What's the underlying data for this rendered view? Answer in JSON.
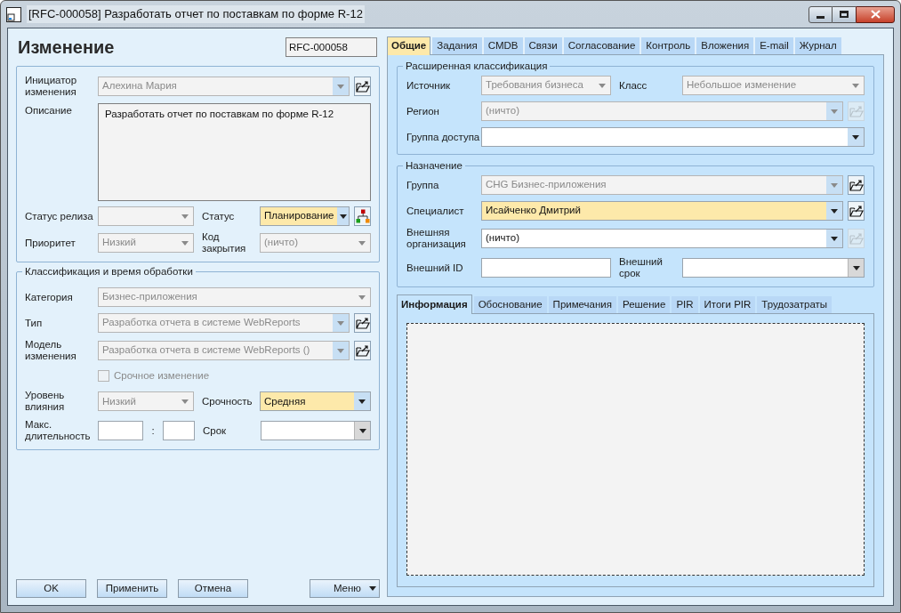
{
  "window": {
    "title": "[RFC-000058] Разработать отчет по поставкам по форме R-12"
  },
  "header": {
    "title": "Изменение",
    "number": "RFC-000058"
  },
  "main_section": {
    "rows": [
      {
        "fields": [
          {
            "label": "Инициатор изменения",
            "kind": "combo",
            "value": "Алехина Мария",
            "disabled": true,
            "highlighted": false,
            "button": {
              "kind": "link",
              "disabled": false
            }
          }
        ]
      },
      {
        "fields": [
          {
            "label": "Описание",
            "kind": "memo",
            "value": "Разработать отчет по поставкам по форме R-12",
            "disabled": true,
            "highlighted": false
          }
        ]
      },
      {
        "fields": [
          {
            "label": "Статус релиза",
            "kind": "combo",
            "disabled": true,
            "highlighted": false
          },
          {
            "label": "Статус",
            "kind": "combo",
            "value": "Планирование",
            "disabled": false,
            "highlighted": true,
            "button": {
              "kind": "tree",
              "disabled": false
            }
          }
        ]
      },
      {
        "fields": [
          {
            "label": "Приоритет",
            "kind": "combo",
            "value": "Низкий",
            "disabled": true,
            "highlighted": false
          },
          {
            "label": "Код закрытия",
            "kind": "combo",
            "value": "(ничто)",
            "disabled": true,
            "highlighted": false
          }
        ]
      }
    ]
  },
  "classification_section": {
    "legend": "Классификация и время обработки",
    "rows": [
      {
        "fields": [
          {
            "label": "Категория",
            "kind": "combo",
            "value": "Бизнес-приложения",
            "disabled": true,
            "highlighted": false
          }
        ]
      },
      {
        "fields": [
          {
            "label": "Тип",
            "kind": "combo",
            "value": "Разработка отчета в системе WebReports",
            "disabled": true,
            "highlighted": false,
            "button": {
              "kind": "link",
              "disabled": false
            }
          }
        ]
      },
      {
        "fields": [
          {
            "label": "Модель изменения",
            "kind": "combo",
            "value": "Разработка отчета в системе WebReports ()",
            "disabled": true,
            "highlighted": false,
            "button": {
              "kind": "link",
              "disabled": false
            }
          }
        ]
      },
      {
        "fields": [
          {
            "kind": "checkbox",
            "value": "Срочное изменение",
            "checked": false,
            "disabled": true
          }
        ]
      },
      {
        "fields": [
          {
            "label": "Уровень влияния",
            "kind": "combo",
            "value": "Низкий",
            "disabled": true,
            "highlighted": false
          },
          {
            "label": "Срочность",
            "kind": "combo",
            "value": "Средняя",
            "disabled": false,
            "highlighted": true
          }
        ]
      },
      {
        "fields": [
          {
            "label": "Макс. длительность",
            "kind": "duration",
            "separator": ":",
            "disabled": false
          },
          {
            "label": "Срок",
            "kind": "date",
            "disabled": false,
            "highlighted": false
          }
        ]
      }
    ]
  },
  "buttons": [
    {
      "label": "OK",
      "kind": "plain"
    },
    {
      "label": "Применить",
      "kind": "plain"
    },
    {
      "label": "Отмена",
      "kind": "plain"
    },
    {
      "label": "Меню",
      "kind": "menu"
    }
  ],
  "tabs": [
    {
      "label": "Общие",
      "selected": true
    },
    {
      "label": "Задания",
      "selected": false
    },
    {
      "label": "CMDB",
      "selected": false
    },
    {
      "label": "Связи",
      "selected": false
    },
    {
      "label": "Согласование",
      "selected": false
    },
    {
      "label": "Контроль",
      "selected": false
    },
    {
      "label": "Вложения",
      "selected": false
    },
    {
      "label": "E-mail",
      "selected": false
    },
    {
      "label": "Журнал",
      "selected": false
    }
  ],
  "right_sections": [
    {
      "legend": "Расширенная классификация",
      "rows": [
        {
          "fields": [
            {
              "label": "Источник",
              "kind": "combo",
              "value": "Требования бизнеса",
              "disabled": true,
              "highlighted": false
            },
            {
              "label": "Класс",
              "kind": "combo",
              "value": "Небольшое изменение",
              "disabled": true,
              "highlighted": false
            }
          ]
        },
        {
          "fields": [
            {
              "label": "Регион",
              "kind": "combo",
              "value": "(ничто)",
              "disabled": true,
              "highlighted": false,
              "button": {
                "kind": "link",
                "disabled": true
              }
            }
          ]
        },
        {
          "fields": [
            {
              "label": "Группа доступа",
              "kind": "combo",
              "disabled": false,
              "highlighted": false
            }
          ]
        }
      ]
    },
    {
      "legend": "Назначение",
      "rows": [
        {
          "fields": [
            {
              "label": "Группа",
              "kind": "combo",
              "value": "CHG Бизнес-приложения",
              "disabled": true,
              "highlighted": false,
              "button": {
                "kind": "link",
                "disabled": false
              }
            }
          ]
        },
        {
          "fields": [
            {
              "label": "Специалист",
              "kind": "combo",
              "value": "Исайченко Дмитрий",
              "disabled": false,
              "highlighted": true,
              "button": {
                "kind": "link",
                "disabled": false
              }
            }
          ]
        },
        {
          "fields": [
            {
              "label": "Внешняя организация",
              "kind": "combo",
              "value": "(ничто)",
              "disabled": false,
              "highlighted": false,
              "button": {
                "kind": "link",
                "disabled": true
              }
            }
          ]
        },
        {
          "fields": [
            {
              "label": "Внешний ID",
              "kind": "text",
              "disabled": false,
              "highlighted": false
            },
            {
              "label": "Внешний срок",
              "kind": "date",
              "disabled": false,
              "highlighted": false
            }
          ]
        }
      ]
    }
  ],
  "subtabs": [
    {
      "label": "Информация",
      "selected": true
    },
    {
      "label": "Обоснование",
      "selected": false
    },
    {
      "label": "Примечания",
      "selected": false
    },
    {
      "label": "Решение",
      "selected": false
    },
    {
      "label": "PIR",
      "selected": false
    },
    {
      "label": "Итоги PIR",
      "selected": false
    },
    {
      "label": "Трудозатраты",
      "selected": false
    }
  ]
}
